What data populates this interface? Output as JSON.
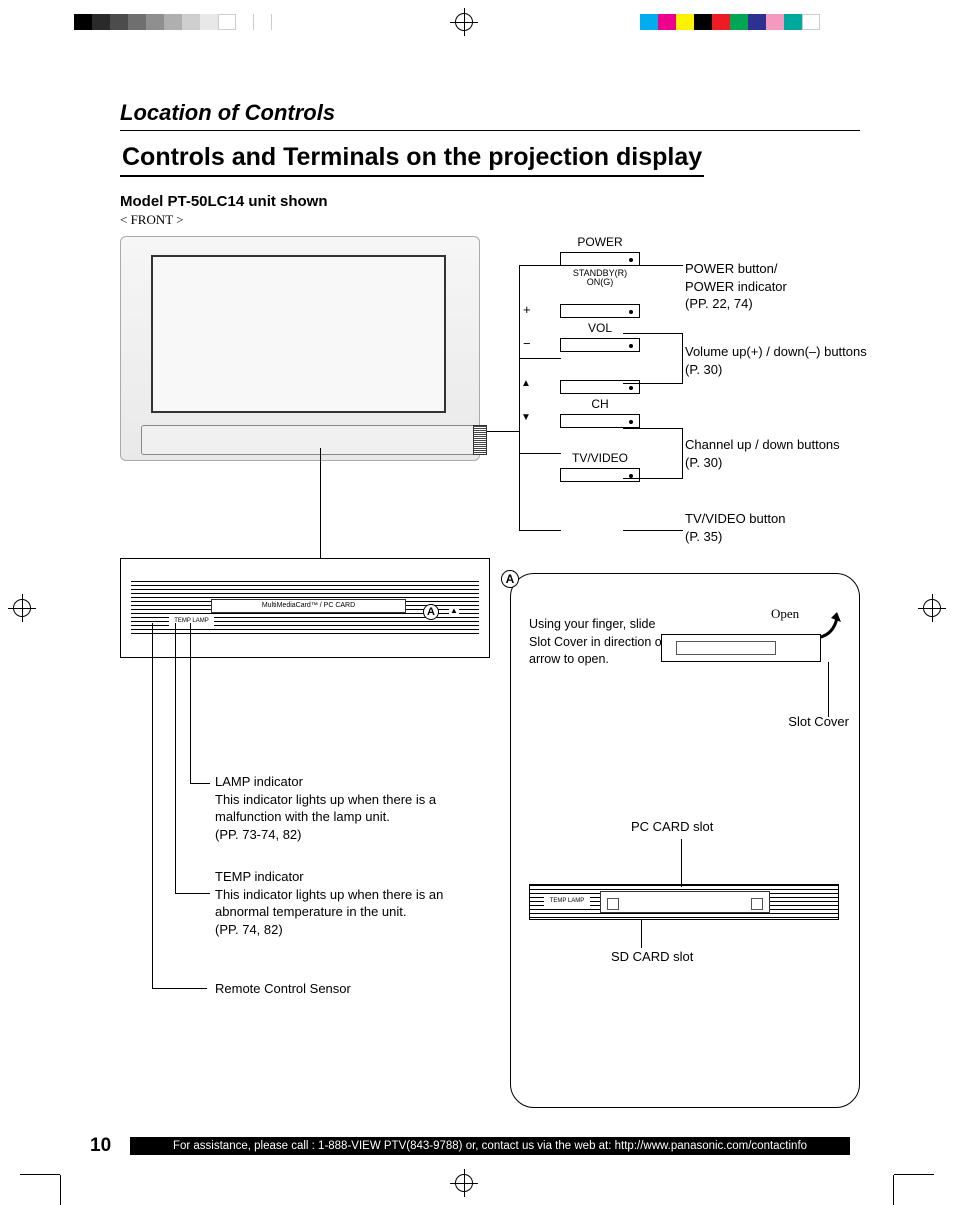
{
  "section_title": "Location of Controls",
  "main_title": "Controls and Terminals on the projection display",
  "model_line": "Model PT-50LC14 unit shown",
  "front_label": "< FRONT >",
  "controls": {
    "power_label": "POWER",
    "standby_line1": "STANDBY(R)",
    "standby_line2": "ON(G)",
    "vol_label": "VOL",
    "ch_label": "CH",
    "tvvideo_label": "TV/VIDEO",
    "plus": "+",
    "minus": "−",
    "up": "▲",
    "down": "▼"
  },
  "callouts": {
    "power": "POWER button/\nPOWER indicator\n(PP. 22, 74)",
    "volume": "Volume up(+) / down(–) buttons\n(P. 30)",
    "channel": "Channel up / down buttons\n(P. 30)",
    "tvvideo": "TV/VIDEO button\n(P. 35)",
    "lamp": "LAMP indicator\nThis indicator lights up when there is a malfunction with the lamp unit.\n(PP. 73-74, 82)",
    "temp": "TEMP indicator\nThis indicator lights up when there is an abnormal temperature in the unit.\n(PP. 74, 82)",
    "remote": "Remote Control Sensor"
  },
  "panel_a": {
    "letter": "A",
    "slot_strip_text": "MultiMediaCard™ / PC CARD",
    "temp_lamp_text": "TEMP   LAMP",
    "eject": "▲",
    "open_instruction": "Using your finger, slide Slot Cover in direction of arrow to open.",
    "open_word": "Open",
    "slot_cover": "Slot Cover",
    "pc_card": "PC CARD slot",
    "sd_card": "SD CARD slot"
  },
  "page_number": "10",
  "footer": "For assistance, please call : 1-888-VIEW PTV(843-9788) or, contact us via the web at: http://www.panasonic.com/contactinfo"
}
